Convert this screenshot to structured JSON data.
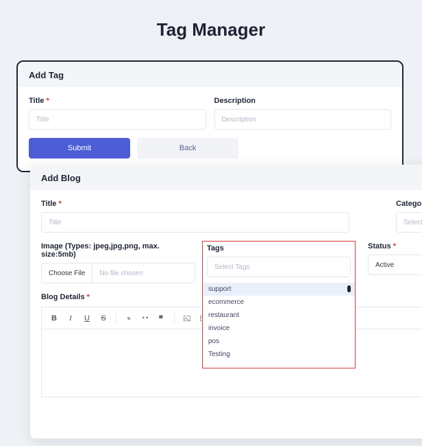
{
  "pageTitle": "Tag Manager",
  "addTag": {
    "header": "Add Tag",
    "titleLabel": "Title",
    "titlePlaceholder": "Title",
    "descLabel": "Description",
    "descPlaceholder": "Description",
    "submit": "Submit",
    "back": "Back"
  },
  "addBlog": {
    "header": "Add Blog",
    "titleLabel": "Title",
    "titlePlaceholder": "Title",
    "categoryLabel": "Category",
    "categoryPlaceholder": "Select",
    "imageLabel": "Image (Types: jpeg,jpg,png, max. size:5mb)",
    "chooseFile": "Choose File",
    "noFile": "No file chosen",
    "tagsLabel": "Tags",
    "tagsPlaceholder": "Select Tags",
    "tagOptions": [
      "support",
      "ecommerce",
      "restaurant",
      "invoice",
      "pos",
      "Testing"
    ],
    "statusLabel": "Status",
    "statusValue": "Active",
    "blogDetailsLabel": "Blog Details"
  }
}
